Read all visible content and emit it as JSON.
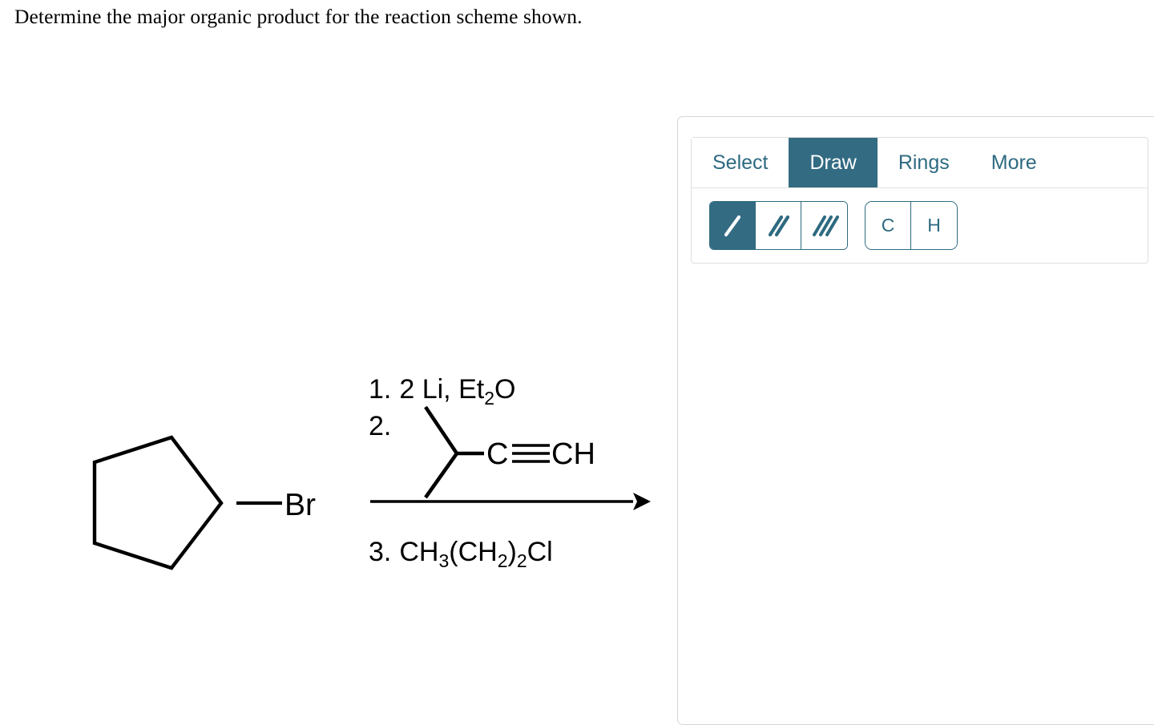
{
  "question": {
    "prompt": "Determine the major organic product for the reaction scheme shown."
  },
  "reaction": {
    "reactant": {
      "name": "bromocyclopentane",
      "substituent_label": "Br"
    },
    "conditions_above": [
      "1. 2 Li, Et2O",
      "2."
    ],
    "condition_1": {
      "number": "1.",
      "reagent_main": "2 Li, Et",
      "reagent_sub": "2",
      "reagent_tail": "O"
    },
    "condition_2": {
      "number": "2.",
      "structure_label_c": "C",
      "structure_label_ch": "CH",
      "structure_note": "3-methyl-1-butyne (isopropylacetylene)"
    },
    "condition_3": {
      "number": "3.",
      "part_1": "CH",
      "sub_1": "3",
      "part_2": "(CH",
      "sub_2": "2",
      "part_3": ")",
      "sub_3": "2",
      "part_4": "Cl"
    },
    "arrow": "reaction-arrow-right"
  },
  "editor": {
    "tabs": [
      {
        "label": "Select",
        "active": false,
        "name": "tab-select"
      },
      {
        "label": "Draw",
        "active": true,
        "name": "tab-draw"
      },
      {
        "label": "Rings",
        "active": false,
        "name": "tab-rings"
      },
      {
        "label": "More",
        "active": false,
        "name": "tab-more"
      }
    ],
    "bond_tools": [
      {
        "icon": "single-bond-icon",
        "active": true
      },
      {
        "icon": "double-bond-icon",
        "active": false
      },
      {
        "icon": "triple-bond-icon",
        "active": false
      }
    ],
    "atom_tools": [
      {
        "label": "C",
        "name": "atom-tool-carbon"
      },
      {
        "label": "H",
        "name": "atom-tool-hydrogen"
      }
    ]
  },
  "colors": {
    "accent": "#336b82",
    "accent_text": "#2e6a81",
    "panel_border": "#d6d6d6",
    "toolbar_border": "#dedede",
    "ink": "#000000"
  }
}
